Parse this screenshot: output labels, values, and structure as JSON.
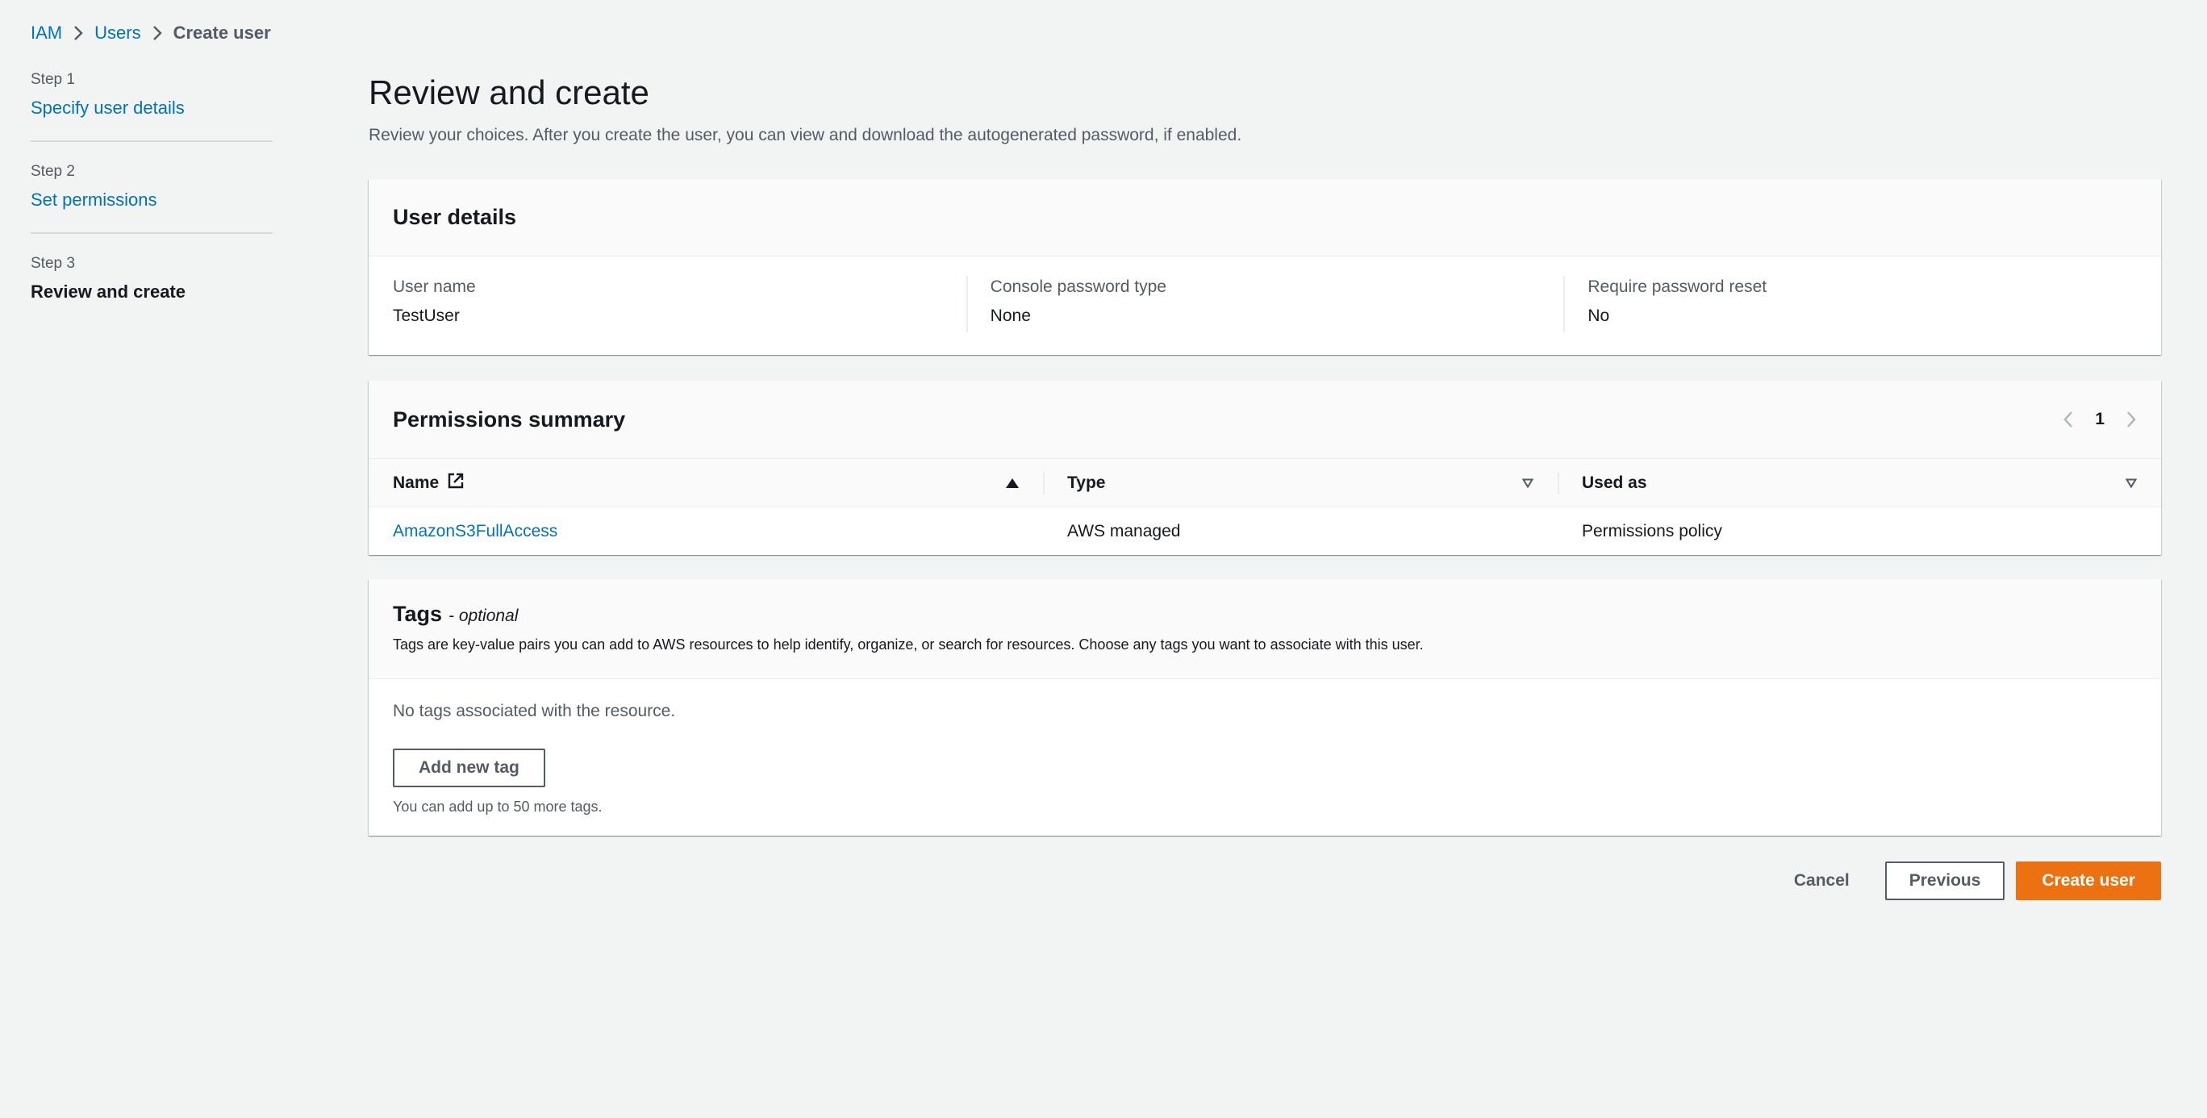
{
  "breadcrumb": {
    "items": [
      "IAM",
      "Users"
    ],
    "current": "Create user"
  },
  "wizard": {
    "steps": [
      {
        "label": "Step 1",
        "title": "Specify user details"
      },
      {
        "label": "Step 2",
        "title": "Set permissions"
      },
      {
        "label": "Step 3",
        "title": "Review and create"
      }
    ]
  },
  "page": {
    "title": "Review and create",
    "description": "Review your choices. After you create the user, you can view and download the autogenerated password, if enabled."
  },
  "user_details": {
    "title": "User details",
    "fields": [
      {
        "key": "User name",
        "value": "TestUser"
      },
      {
        "key": "Console password type",
        "value": "None"
      },
      {
        "key": "Require password reset",
        "value": "No"
      }
    ]
  },
  "permissions": {
    "title": "Permissions summary",
    "page_number": "1",
    "columns": [
      "Name",
      "Type",
      "Used as"
    ],
    "rows": [
      {
        "name": "AmazonS3FullAccess",
        "type": "AWS managed",
        "used_as": "Permissions policy"
      }
    ]
  },
  "tags": {
    "title": "Tags",
    "optional": "- optional",
    "description": "Tags are key-value pairs you can add to AWS resources to help identify, organize, or search for resources. Choose any tags you want to associate with this user.",
    "empty": "No tags associated with the resource.",
    "add_label": "Add new tag",
    "hint": "You can add up to 50 more tags."
  },
  "actions": {
    "cancel": "Cancel",
    "previous": "Previous",
    "create": "Create user"
  },
  "colors": {
    "link": "#0073bb",
    "primary": "#ec7211",
    "background": "#f2f3f3"
  }
}
